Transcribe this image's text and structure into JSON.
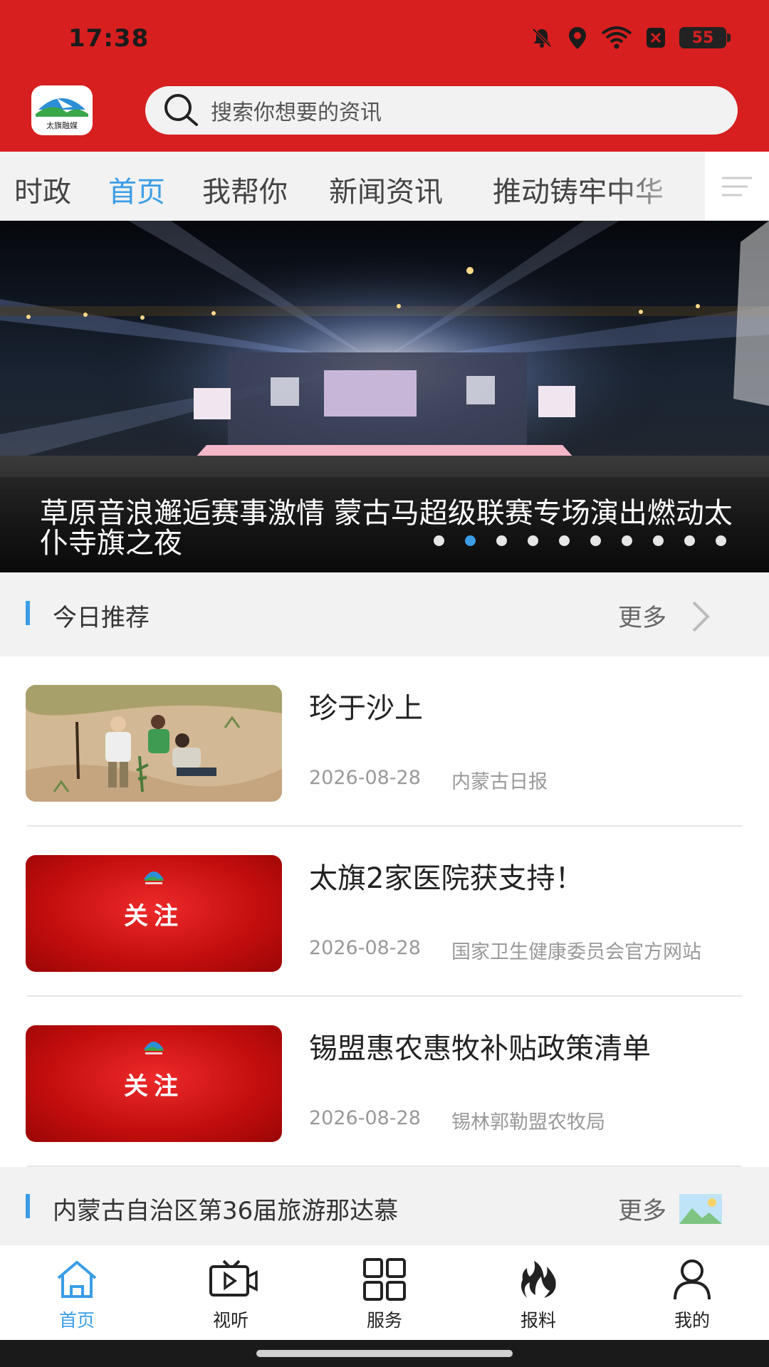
{
  "status_bar": {
    "time": "17:38",
    "battery": "55"
  },
  "header": {
    "logo_text": "太旗融媒",
    "search_placeholder": "搜索你想要的资讯"
  },
  "tabs": [
    "时政",
    "首页",
    "我帮你",
    "新闻资讯",
    "推动铸牢中华"
  ],
  "active_tab": "首页",
  "banner": {
    "caption": "草原音浪邂逅赛事激情 蒙古马超级联赛专场演出燃动太仆寺旗之夜",
    "dot_count": 10,
    "active_dot_index": 1
  },
  "section_today": {
    "title": "今日推荐",
    "more": "更多"
  },
  "news": [
    {
      "title": "珍于沙上",
      "date": "2026-08-28",
      "source": "内蒙古日报",
      "thumb": "photo-tree-planting"
    },
    {
      "title": "太旗2家医院获支持！",
      "date": "2026-08-28",
      "source": "国家卫生健康委员会官方网站",
      "thumb": "red-guanzhu",
      "thumb_label": "关注"
    },
    {
      "title": "锡盟惠农惠牧补贴政策清单",
      "date": "2026-08-28",
      "source": "锡林郭勒盟农牧局",
      "thumb": "red-guanzhu",
      "thumb_label": "关注"
    }
  ],
  "section_next": {
    "title": "内蒙古自治区第36届旅游那达慕",
    "more": "更多"
  },
  "bottom_nav": [
    {
      "label": "首页",
      "icon": "home-icon",
      "active": true
    },
    {
      "label": "视听",
      "icon": "tv-play-icon",
      "active": false
    },
    {
      "label": "服务",
      "icon": "grid-icon",
      "active": false
    },
    {
      "label": "报料",
      "icon": "flame-icon",
      "active": false
    },
    {
      "label": "我的",
      "icon": "user-icon",
      "active": false
    }
  ],
  "colors": {
    "brand_red": "#d71f1f",
    "accent_blue": "#3a9de6"
  }
}
